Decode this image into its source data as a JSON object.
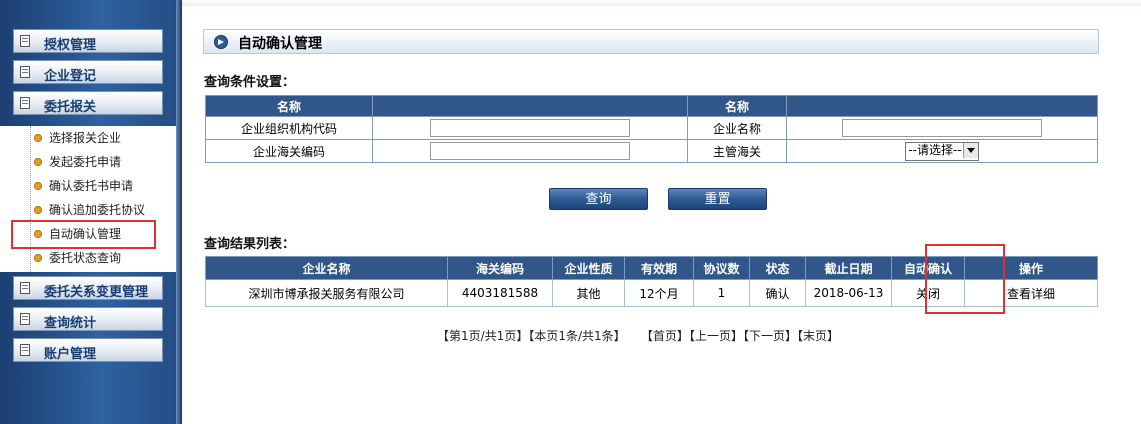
{
  "sidebar": {
    "menu": [
      "授权管理",
      "企业登记",
      "委托报关",
      "委托关系变更管理",
      "查询统计",
      "账户管理"
    ],
    "submenu": [
      "选择报关企业",
      "发起委托申请",
      "确认委托书申请",
      "确认追加委托协议",
      "自动确认管理",
      "委托状态查询"
    ]
  },
  "page": {
    "title": "自动确认管理",
    "query_section": "查询条件设置：",
    "result_section": "查询结果列表："
  },
  "query": {
    "headers": [
      "名称",
      "名称"
    ],
    "rows": [
      [
        "企业组织机构代码",
        "企业名称"
      ],
      [
        "企业海关编码",
        "主管海关"
      ]
    ],
    "select_value": "--请选择--",
    "buttons": [
      "查询",
      "重置"
    ]
  },
  "results": {
    "headers": [
      "企业名称",
      "海关编码",
      "企业性质",
      "有效期",
      "协议数",
      "状态",
      "截止日期",
      "自动确认",
      "操作"
    ],
    "row": [
      "深圳市博承报关服务有限公司",
      "4403181588",
      "其他",
      "12个月",
      "1",
      "确认",
      "2018-06-13",
      "关闭",
      "查看详细"
    ]
  },
  "pager": {
    "info1": "【第1页/共1页】",
    "info2": "【本页1条/共1条】",
    "first": "【首页】",
    "prev": "【上一页】",
    "next": "【下一页】",
    "last": "【末页】"
  },
  "colors": {
    "header": "#30568a",
    "highlight": "#e23030",
    "sidebar": "#2b5a97"
  }
}
